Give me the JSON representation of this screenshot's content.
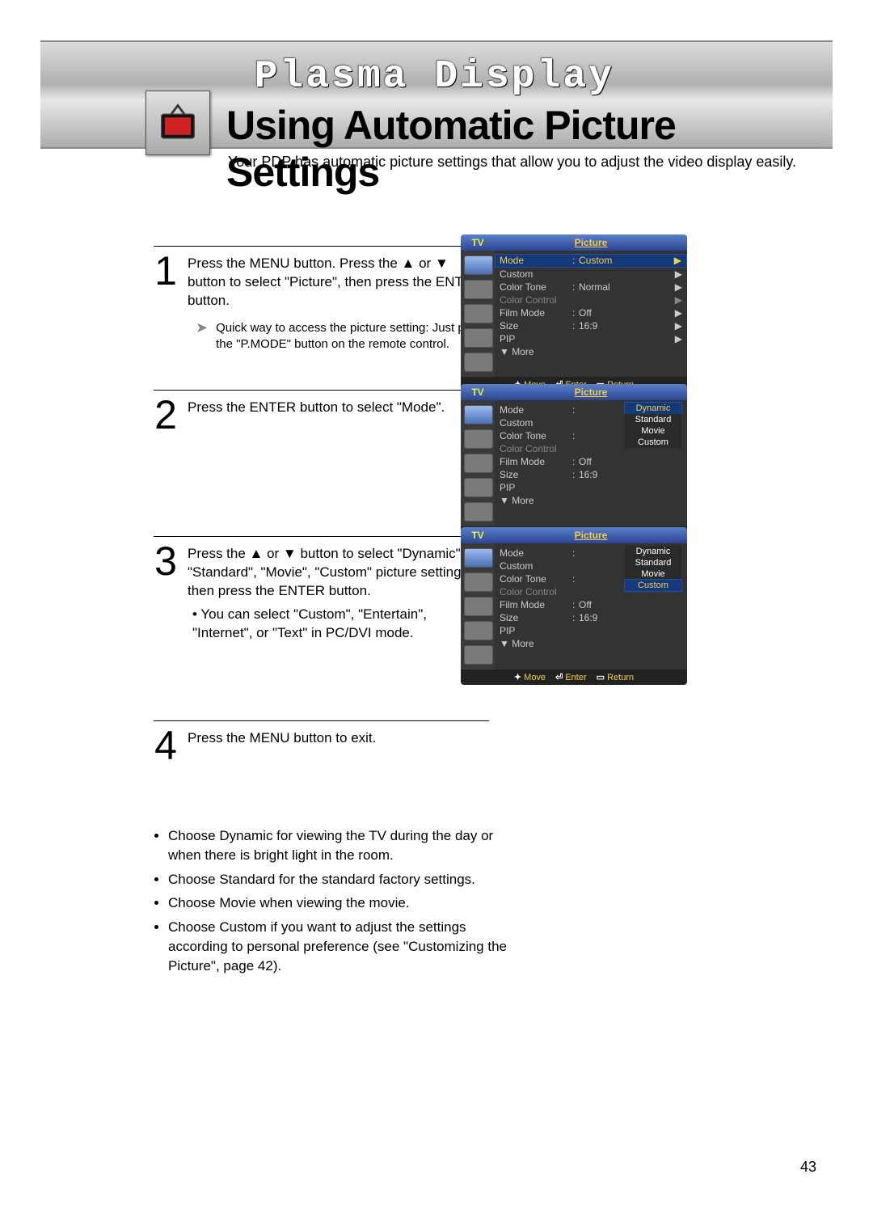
{
  "header": {
    "brand": "Plasma Display",
    "title": "Using Automatic Picture Settings",
    "intro": "Your PDP has automatic picture settings that allow you to adjust the video display easily."
  },
  "steps": {
    "s1": {
      "num": "1",
      "text": "Press the MENU button. Press the ▲ or ▼ button to select \"Picture\", then press the ENTER button.",
      "quick": "Quick way to access the picture setting: Just press the \"P.MODE\" button on the remote control."
    },
    "s2": {
      "num": "2",
      "text": "Press the ENTER button to select \"Mode\"."
    },
    "s3": {
      "num": "3",
      "line1": "Press the ▲ or ▼ button to select \"Dynamic\", \"Standard\", \"Movie\", \"Custom\" picture setting, then press the ENTER button.",
      "line2": "• You can select \"Custom\", \"Entertain\", \"Internet\", or \"Text\" in PC/DVI mode."
    },
    "s4": {
      "num": "4",
      "text": "Press the MENU button to exit."
    }
  },
  "notes": {
    "n1": "Choose Dynamic for viewing the TV during the day or when there is bright light in the room.",
    "n2": "Choose Standard for the standard factory settings.",
    "n3": "Choose Movie when viewing the movie.",
    "n4": "Choose Custom if you want to adjust the settings according to personal preference (see \"Customizing the Picture\", page 42)."
  },
  "osd": {
    "tv": "TV",
    "title": "Picture",
    "rows": {
      "mode": "Mode",
      "mode_v": "Custom",
      "custom": "Custom",
      "tone": "Color Tone",
      "tone_v": "Normal",
      "cc": "Color Control",
      "film": "Film Mode",
      "film_v": "Off",
      "size": "Size",
      "size_v": "16:9",
      "pip": "PIP",
      "more": "▼ More"
    },
    "popup": {
      "dynamic": "Dynamic",
      "standard": "Standard",
      "movie": "Movie",
      "custom": "Custom"
    },
    "foot_move": "Move",
    "foot_enter": "Enter",
    "foot_return": "Return"
  },
  "page_num": "43"
}
